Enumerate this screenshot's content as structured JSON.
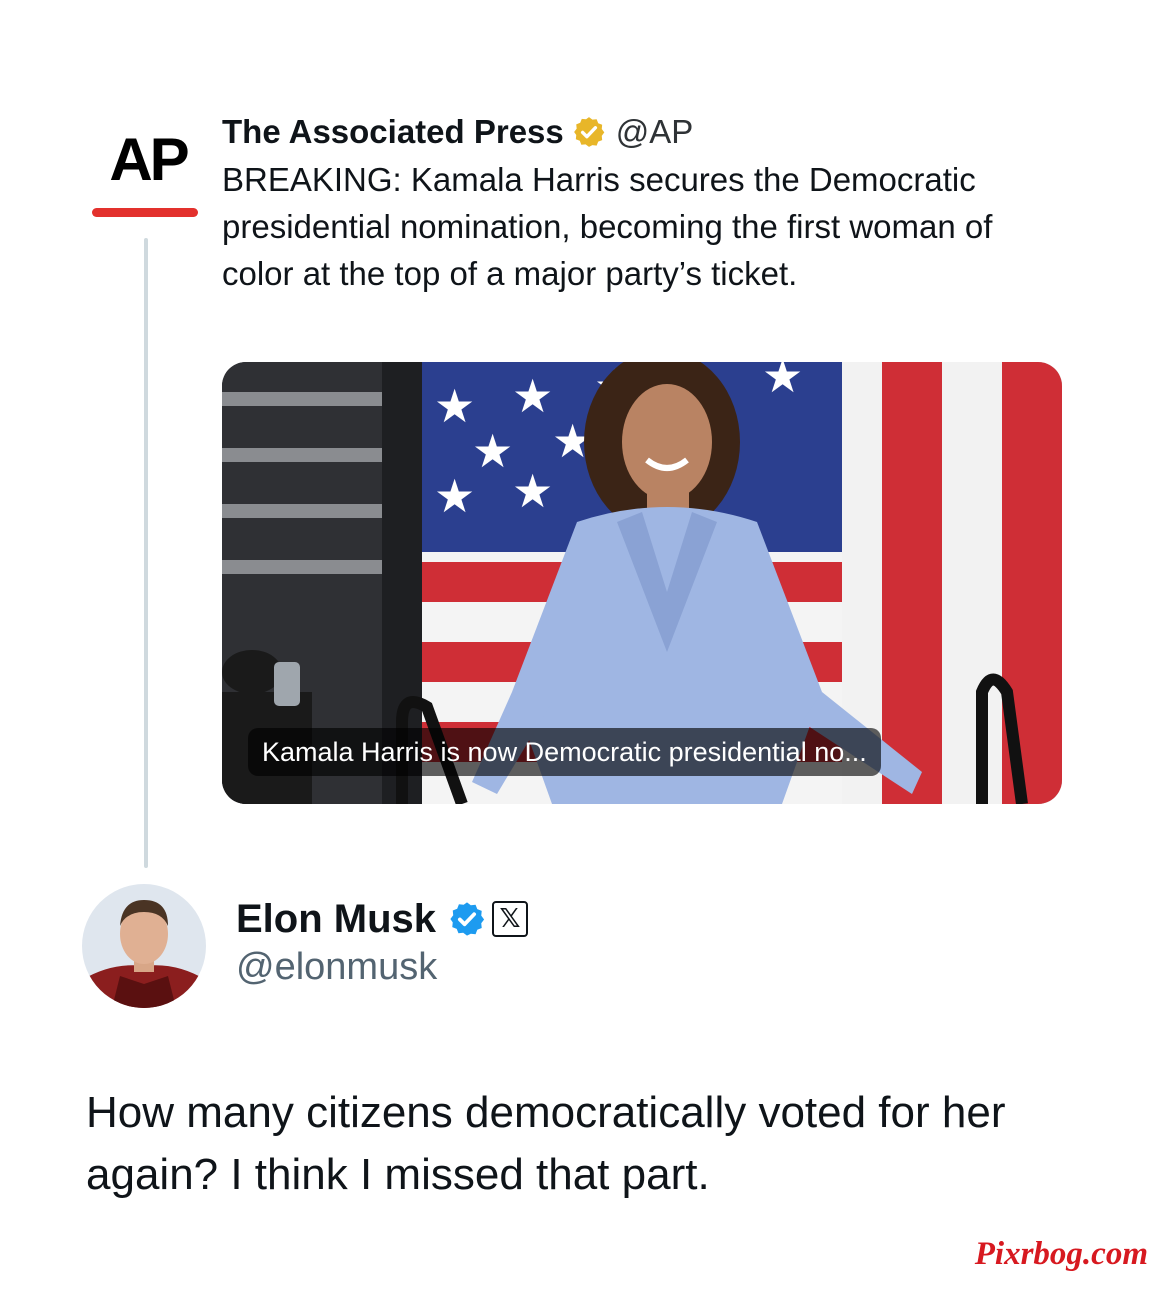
{
  "quoted_tweet": {
    "logo_text": "AP",
    "author_name": "The Associated Press",
    "verified_badge": "gold-check-badge",
    "handle": "@AP",
    "text": "BREAKING: Kamala Harris secures the Democratic presidential nomination, becoming the first woman of color at the top of a major party’s ticket.",
    "media": {
      "caption": "Kamala Harris is now Democratic presidential no..."
    }
  },
  "reply": {
    "author_name": "Elon Musk",
    "verified_badge": "blue-check-badge",
    "affiliate_badge": "𝕏",
    "handle": "@elonmusk",
    "text": "How many citizens democratically voted for her again? I think I missed that part."
  },
  "watermark": "Pixrbog.com",
  "colors": {
    "ap_red": "#e3312d",
    "gold_badge": "#e8b629",
    "blue_badge": "#1d9bf0",
    "thread_line": "#cfd9de",
    "watermark": "#d71920"
  }
}
